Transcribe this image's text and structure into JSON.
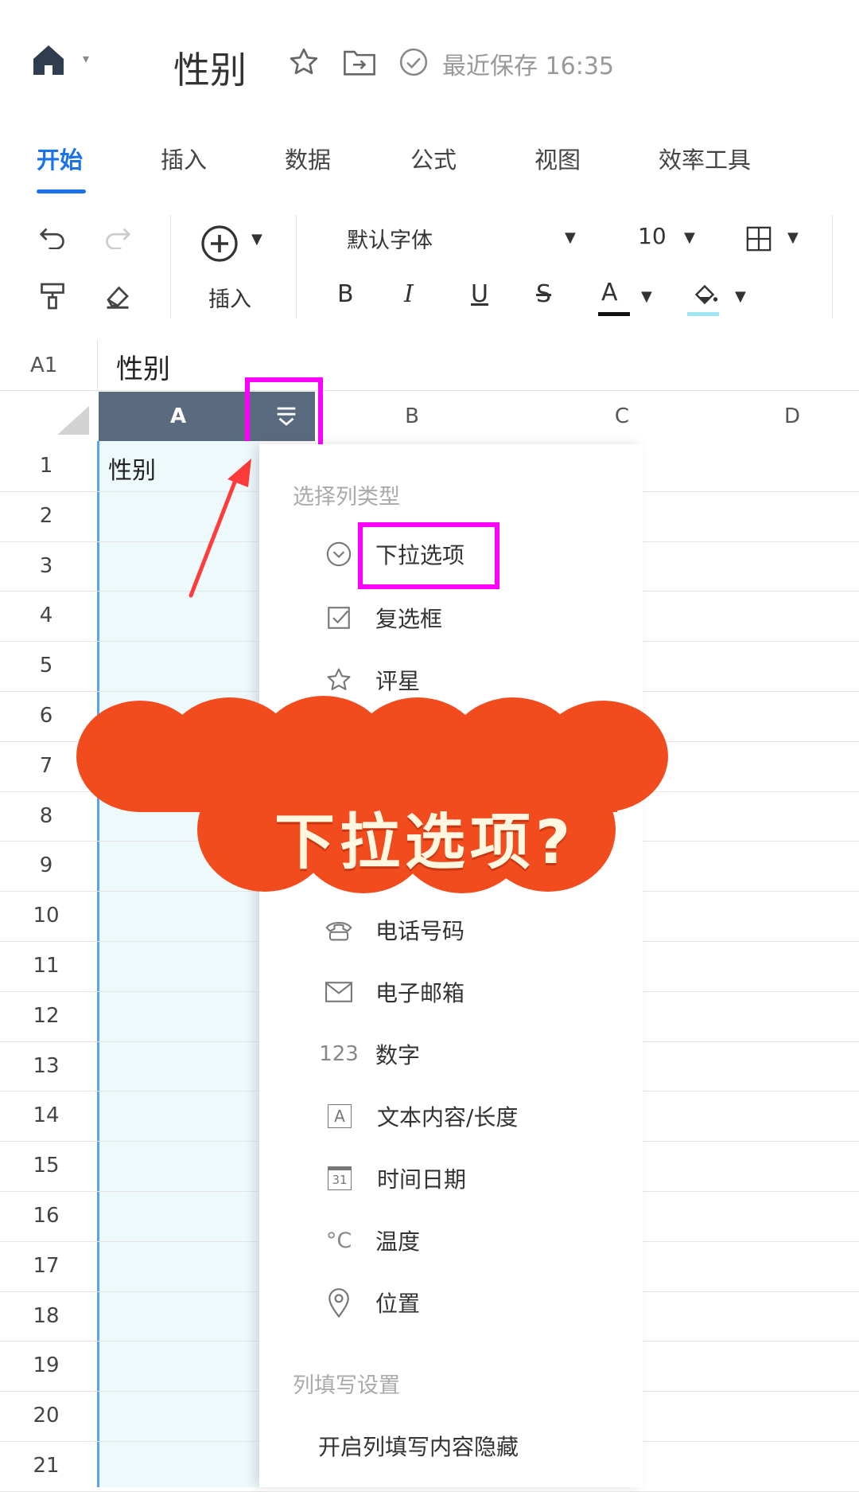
{
  "header": {
    "doc_title": "性别",
    "save_status": "最近保存 16:35"
  },
  "tabs": [
    "开始",
    "插入",
    "数据",
    "公式",
    "视图",
    "效率工具"
  ],
  "toolbar": {
    "insert_label": "插入",
    "font_name": "默认字体",
    "font_size": "10",
    "bold": "B",
    "italic": "I",
    "underline": "U",
    "strike": "S",
    "font_color": "A"
  },
  "formula_bar": {
    "cell_ref": "A1",
    "value": "性别"
  },
  "columns": [
    "A",
    "B",
    "C",
    "D"
  ],
  "rows": [
    "1",
    "2",
    "3",
    "4",
    "5",
    "6",
    "7",
    "8",
    "9",
    "10",
    "11",
    "12",
    "13",
    "14",
    "15",
    "16",
    "17",
    "18",
    "19",
    "20",
    "21"
  ],
  "cell_a1": "性别",
  "menu": {
    "section_title": "选择列类型",
    "items": [
      {
        "label": "下拉选项",
        "icon": "chevron-circle-icon"
      },
      {
        "label": "复选框",
        "icon": "checkbox-icon"
      },
      {
        "label": "评星",
        "icon": "star-icon"
      },
      {
        "label": "电话号码",
        "icon": "phone-icon"
      },
      {
        "label": "电子邮箱",
        "icon": "mail-icon"
      },
      {
        "label": "数字",
        "icon": "number-icon",
        "glyph": "123"
      },
      {
        "label": "文本内容/长度",
        "icon": "text-icon",
        "glyph": "A"
      },
      {
        "label": "时间日期",
        "icon": "calendar-icon",
        "glyph": "31"
      },
      {
        "label": "温度",
        "icon": "temperature-icon",
        "glyph": "°C"
      },
      {
        "label": "位置",
        "icon": "location-icon"
      }
    ],
    "settings_title": "列填写设置",
    "settings_item": "开启列填写内容隐藏"
  },
  "banner": {
    "text": "下拉选项?"
  },
  "colors": {
    "accent": "#1a73e8",
    "highlight": "#ff00ff",
    "banner": "#f24b1d",
    "arrow": "#ff3b3b"
  }
}
